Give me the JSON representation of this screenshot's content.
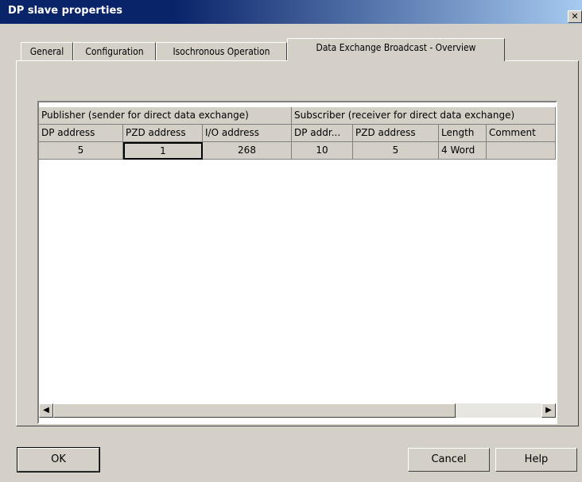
{
  "window": {
    "title": "DP slave properties",
    "close_glyph": "✕"
  },
  "tabs": [
    {
      "label": "General"
    },
    {
      "label": "Configuration"
    },
    {
      "label": "Isochronous Operation"
    },
    {
      "label": "Data Exchange Broadcast - Overview"
    }
  ],
  "active_tab": "Data Exchange Broadcast - Overview",
  "table": {
    "group_headers": [
      "Publisher (sender for direct data exchange)",
      "Subscriber (receiver for direct data exchange)"
    ],
    "columns": [
      "DP address",
      "PZD address",
      "I/O address",
      "DP addr...",
      "PZD address",
      "Length",
      "Comment"
    ],
    "rows": [
      [
        "5",
        "1",
        "268",
        "10",
        "5",
        "4 Word",
        ""
      ]
    ]
  },
  "scrollbar": {
    "left_arrow": "◀",
    "right_arrow": "▶"
  },
  "buttons": {
    "ok": "OK",
    "cancel": "Cancel",
    "help": "Help"
  }
}
